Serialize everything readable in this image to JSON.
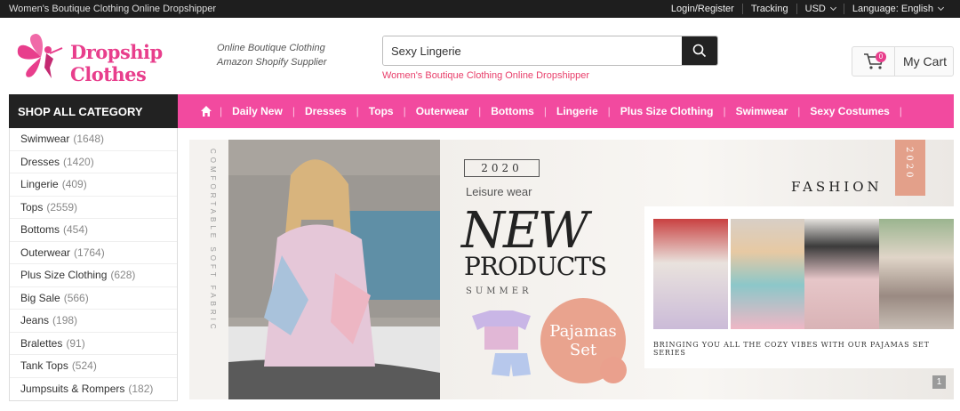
{
  "topbar": {
    "tagline": "Women's Boutique Clothing Online Dropshipper",
    "login": "Login/Register",
    "tracking": "Tracking",
    "currency": "USD",
    "language": "Language: English"
  },
  "header": {
    "logo_text": "Dropship Clothes",
    "tagline_1": "Online Boutique Clothing",
    "tagline_2": "Amazon Shopify Supplier",
    "search_value": "Sexy Lingerie",
    "hot_link": "Women's Boutique Clothing Online Dropshipper",
    "cart_count": "0",
    "cart_label": "My Cart"
  },
  "nav": {
    "shop_all": "SHOP ALL CATEGORY",
    "links": [
      "Daily New",
      "Dresses",
      "Tops",
      "Outerwear",
      "Bottoms",
      "Lingerie",
      "Plus Size Clothing",
      "Swimwear",
      "Sexy Costumes"
    ]
  },
  "categories": [
    {
      "name": "Swimwear",
      "count": "(1648)"
    },
    {
      "name": "Dresses",
      "count": "(1420)"
    },
    {
      "name": "Lingerie",
      "count": "(409)"
    },
    {
      "name": "Tops",
      "count": "(2559)"
    },
    {
      "name": "Bottoms",
      "count": "(454)"
    },
    {
      "name": "Outerwear",
      "count": "(1764)"
    },
    {
      "name": "Plus Size Clothing",
      "count": "(628)"
    },
    {
      "name": "Big Sale",
      "count": "(566)"
    },
    {
      "name": "Jeans",
      "count": "(198)"
    },
    {
      "name": "Bralettes",
      "count": "(91)"
    },
    {
      "name": "Tank Tops",
      "count": "(524)"
    },
    {
      "name": "Jumpsuits & Rompers",
      "count": "(182)"
    }
  ],
  "banner": {
    "side_text": "COMFORTABLE SOFT FABRIC",
    "year": "2020",
    "leisure": "Leisure wear",
    "new": "NEW",
    "products": "PRODUCTS",
    "summer": "SUMMER",
    "pajamas_1": "Pajamas",
    "pajamas_2": "Set",
    "fashion": "FASHION",
    "year_tag": "2020",
    "caption": "BRINGING YOU ALL THE COZY VIBES WITH OUR PAJAMAS SET SERIES",
    "page": "1"
  },
  "colors": {
    "nav_pink": "#f24a9f",
    "dark": "#222222",
    "accent_peach": "#e9a38e"
  }
}
